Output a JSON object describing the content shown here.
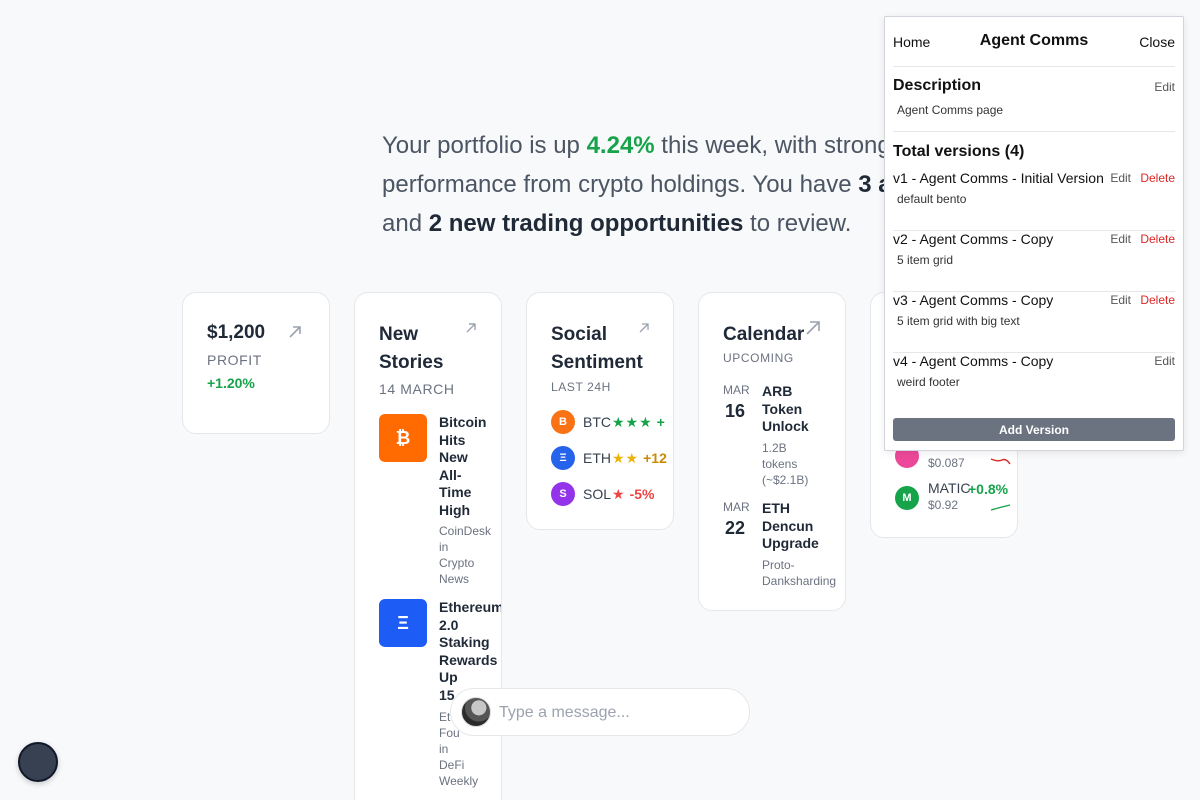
{
  "summary": {
    "p1": "Your portfolio is up ",
    "pct": "4.24%",
    "p2": " this week, with strong",
    "p3": "performance from crypto holdings. You have ",
    "alerts": "3 a",
    "p4": "and ",
    "opps": "2 new trading opportunities",
    "p5": " to review."
  },
  "profit": {
    "value": "$1,200",
    "label": "PROFIT",
    "change": "+1.20%",
    "change_color": "#16a34a"
  },
  "stories": {
    "title_line1": "New",
    "title_line2": "Stories",
    "date": "14 MARCH",
    "items": [
      {
        "icon": "bitcoin-icon",
        "glyph": "₿",
        "color": "#ff6b00",
        "title_lines": [
          "Bitcoin",
          "Hits",
          "New",
          "All-",
          "Time",
          "High"
        ],
        "meta_lines": [
          "CoinDesk",
          "in",
          "Crypto",
          "News"
        ]
      },
      {
        "icon": "ethereum-icon",
        "glyph": "Ξ",
        "color": "#1d5cf5",
        "title_lines": [
          "Ethereum",
          "2.0",
          "Staking",
          "Rewards",
          "Up",
          "15"
        ],
        "meta_lines": [
          "Et",
          "Fou",
          "in",
          "DeFi",
          "Weekly"
        ]
      }
    ]
  },
  "sentiment": {
    "title_line1": "Social",
    "title_line2": "Sentiment",
    "sub": "LAST 24H",
    "rows": [
      {
        "symbol": "BTC",
        "glyph": "B",
        "coin_color": "#f97316",
        "stars": "★★★",
        "star_color": "#16a34a",
        "change": "+",
        "change_color": "#16a34a"
      },
      {
        "symbol": "ETH",
        "glyph": "Ξ",
        "coin_color": "#2563eb",
        "stars": "★★",
        "star_color": "#eab308",
        "change": "+12",
        "change_color": "#ca8a04"
      },
      {
        "symbol": "SOL",
        "glyph": "S",
        "coin_color": "#9333ea",
        "stars": "★",
        "star_color": "#ef4444",
        "change": "-5%",
        "change_color": "#ef4444"
      }
    ]
  },
  "calendar": {
    "title": "Calendar",
    "sub": "UPCOMING",
    "events": [
      {
        "month": "MAR",
        "day": "16",
        "title_lines": [
          "ARB",
          "Token",
          "Unlock"
        ],
        "meta_lines": [
          "1.2B",
          "tokens",
          "(~$2.1B)"
        ]
      },
      {
        "month": "MAR",
        "day": "22",
        "title_lines": [
          "ETH",
          "Dencun",
          "Upgrade"
        ],
        "meta_lines": [
          "Proto-",
          "Danksharding"
        ]
      }
    ]
  },
  "market": {
    "rows": [
      {
        "symbol": "",
        "glyph": "",
        "coin_color": "#ec4899",
        "price": "$0.087",
        "change": "",
        "change_color": "#dc2626",
        "trend": "down"
      },
      {
        "symbol": "MATIC",
        "glyph": "M",
        "coin_color": "#16a34a",
        "price": "$0.92",
        "change": "+0.8%",
        "change_color": "#16a34a",
        "trend": "up"
      }
    ]
  },
  "chat": {
    "placeholder": "Type a message..."
  },
  "panel": {
    "home": "Home",
    "title": "Agent Comms",
    "close": "Close",
    "description_heading": "Description",
    "description_edit": "Edit",
    "description_text": "Agent Comms page",
    "versions_heading": "Total versions (4)",
    "versions": [
      {
        "name": "v1 - Agent Comms - Initial Version",
        "desc": "default bento",
        "edit": "Edit",
        "delete": "Delete"
      },
      {
        "name": "v2 - Agent Comms - Copy",
        "desc": "5 item grid",
        "edit": "Edit",
        "delete": "Delete"
      },
      {
        "name": "v3 - Agent Comms - Copy",
        "desc": "5 item grid with big text",
        "edit": "Edit",
        "delete": "Delete"
      },
      {
        "name": "v4 - Agent Comms - Copy",
        "desc": "weird footer",
        "edit": "Edit"
      }
    ],
    "add_version": "Add Version"
  }
}
